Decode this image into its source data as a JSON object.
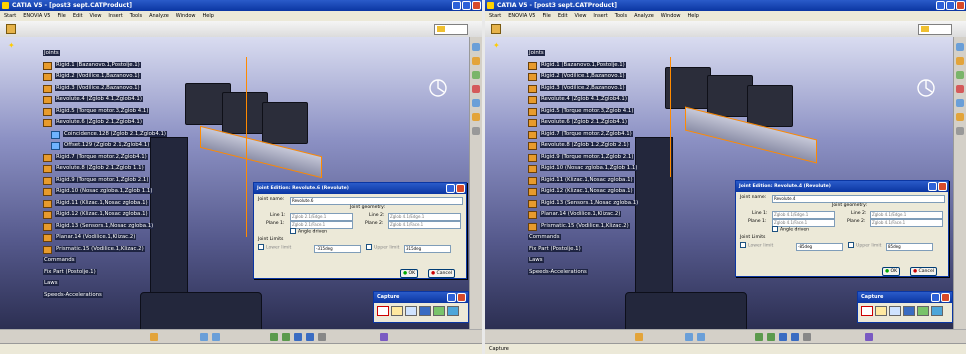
{
  "left": {
    "title": "CATIA V5 - [post3 sept.CATProduct]",
    "menu": [
      "Start",
      "ENOVIA V5",
      "File",
      "Edit",
      "View",
      "Insert",
      "Tools",
      "Analyze",
      "Window",
      "Help"
    ],
    "tree": {
      "root": "Joints",
      "items": [
        {
          "label": "Rigid.1 (Bazanovo.1,Postolje.1)",
          "child": false
        },
        {
          "label": "Rigid.2 (Vodilice.1,Bazanovo.1)",
          "child": false
        },
        {
          "label": "Rigid.3 (Vodilice.2,Bazanovo.1)",
          "child": false
        },
        {
          "label": "Revolute.4 (Zglob 4.1,Zglob4.1)",
          "child": false
        },
        {
          "label": "Rigid.5 (Torque motor.3,Zglob 4.1)",
          "child": false
        },
        {
          "label": "Revolute.6 (Zglob 2.1,Zglob4.1)",
          "child": false
        },
        {
          "label": "Coincidence.128 (Zglob 2.1,Zglob4.1)",
          "child": true
        },
        {
          "label": "Offset.129 (Zglob 2.1,Zglob4.1)",
          "child": true
        },
        {
          "label": "Rigid.7 (Torque motor.2,Zglob4.1)",
          "child": false
        },
        {
          "label": "Revolute.8 (Zglob 2.1,Zglob 1.1)",
          "child": false
        },
        {
          "label": "Rigid.9 (Torque motor.1,Zglob 2.1)",
          "child": false
        },
        {
          "label": "Rigid.10 (Nosac zgloba.1,Zglob 1.1)",
          "child": false
        },
        {
          "label": "Rigid.11 (Klizac.1,Nosac zgloba.1)",
          "child": false
        },
        {
          "label": "Rigid.12 (Klizac.1,Nosac zgloba.1)",
          "child": false
        },
        {
          "label": "Rigid.13 (Sensors.1,Nosac zgloba.1)",
          "child": false
        },
        {
          "label": "Planar.14 (Vodilice.1,Klizac.2)",
          "child": false
        },
        {
          "label": "Prismatic.15 (Vodilice.1,Klizac.2)",
          "child": false
        }
      ],
      "footer": [
        "Commands",
        "Fix Part (Postolje.1)",
        "Laws",
        "Speeds-Accelerations"
      ]
    },
    "dialog": {
      "title": "Joint Edition: Revolute.6 (Revolute)",
      "joint_name_label": "Joint name:",
      "joint_name": "Revolute.6",
      "geometry_label": "Joint geometry:",
      "line1_label": "Line 1:",
      "line1_value": "Zglob 2.1/Edge.1",
      "line2_label": "Line 2:",
      "line2_value": "Zglob 4.1/Edge.1",
      "plane1_label": "Plane 1:",
      "plane1_value": "Zglob 2.1/Face.1",
      "plane2_label": "Plane 2:",
      "plane2_value": "Zglob 4.1/Face.1",
      "angle_driven_label": "Angle driven",
      "limits_label": "Joint Limits",
      "lower_label": "Lower limit",
      "lower_value": "-315deg",
      "upper_label": "Upper limit",
      "upper_value": "315deg",
      "ok_label": "OK",
      "cancel_label": "Cancel"
    },
    "capture_title": "Capture",
    "status": ""
  },
  "right": {
    "title": "CATIA V5 - [post3 sept.CATProduct]",
    "menu": [
      "Start",
      "ENOVIA V5",
      "File",
      "Edit",
      "View",
      "Insert",
      "Tools",
      "Analyze",
      "Window",
      "Help"
    ],
    "tree": {
      "root": "Joints",
      "items": [
        {
          "label": "Rigid.1 (Bazanovo.1,Postolje.1)",
          "child": false
        },
        {
          "label": "Rigid.2 (Vodilice.1,Bazanovo.1)",
          "child": false
        },
        {
          "label": "Rigid.3 (Vodilice.2,Bazanovo.1)",
          "child": false
        },
        {
          "label": "Revolute.4 (Zglob 4.1,Zglob4.1)",
          "child": false
        },
        {
          "label": "Rigid.5 (Torque motor.3,Zglob 4.1)",
          "child": false
        },
        {
          "label": "Revolute.6 (Zglob 2.1,Zglob4.1)",
          "child": false
        },
        {
          "label": "Rigid.7 (Torque motor.2,Zglob4.1)",
          "child": false
        },
        {
          "label": "Revolute.8 (Zglob 1.2,Zglob 2.1)",
          "child": false
        },
        {
          "label": "Rigid.9 (Torque motor.1,Zglob 2.1)",
          "child": false
        },
        {
          "label": "Rigid.10 (Nosac zgloba.1,Zglob 1.1)",
          "child": false
        },
        {
          "label": "Rigid.11 (Klizac.1,Nosac zgloba.1)",
          "child": false
        },
        {
          "label": "Rigid.12 (Klizac.1,Nosac zgloba.1)",
          "child": false
        },
        {
          "label": "Rigid.13 (Sensors.1,Nosac zgloba.1)",
          "child": false
        },
        {
          "label": "Planar.14 (Vodilice.1,Klizac.2)",
          "child": false
        },
        {
          "label": "Prismatic.15 (Vodilice.1,Klizac.2)",
          "child": false
        }
      ],
      "footer": [
        "Commands",
        "Fix Part (Postolje.1)",
        "Laws",
        "Speeds-Accelerations"
      ]
    },
    "dialog": {
      "title": "Joint Edition: Revolute.4 (Revolute)",
      "joint_name_label": "Joint name:",
      "joint_name": "Revolute.4",
      "geometry_label": "Joint geometry:",
      "line1_label": "Line 1:",
      "line1_value": "Zglob 4.1/Edge.1",
      "line2_label": "Line 2:",
      "line2_value": "Zglob 4.1/Edge.1",
      "plane1_label": "Plane 1:",
      "plane1_value": "Zglob 4.1/Face.1",
      "plane2_label": "Plane 2:",
      "plane2_value": "Zglob 4.1/Face.1",
      "angle_driven_label": "Angle driven",
      "limits_label": "Joint Limits",
      "lower_label": "Lower limit",
      "lower_value": "-85deg",
      "upper_label": "Upper limit",
      "upper_value": "85deg",
      "ok_label": "OK",
      "cancel_label": "Cancel"
    },
    "capture_title": "Capture",
    "status": "Capture"
  }
}
